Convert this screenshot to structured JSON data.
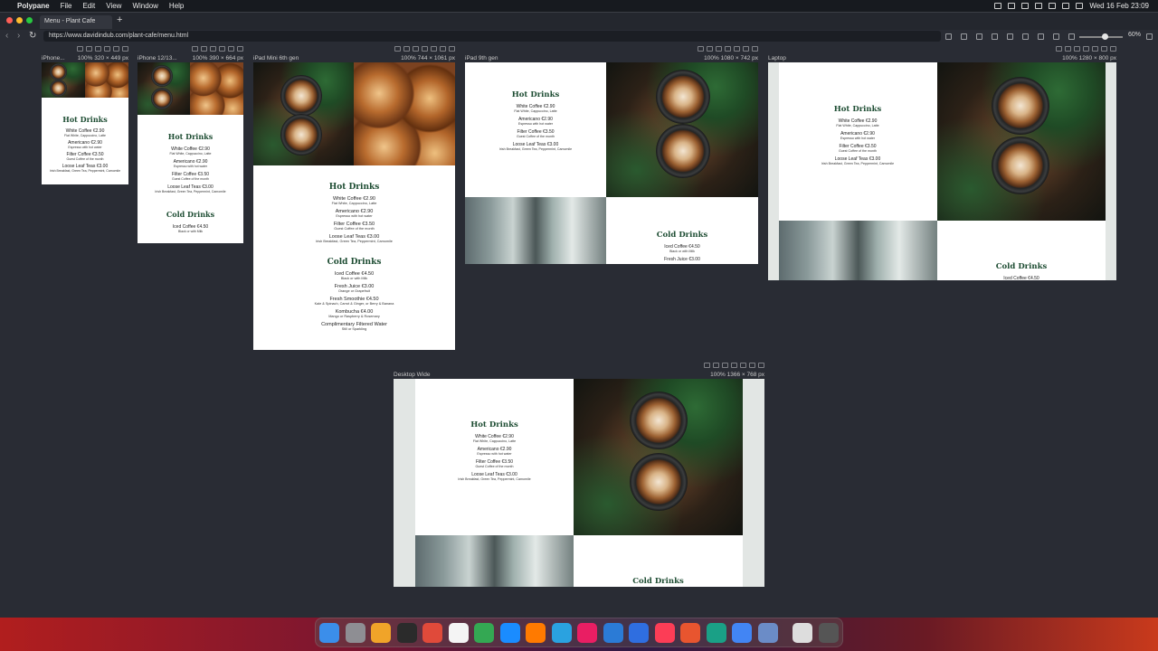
{
  "menubar": {
    "app": "Polypane",
    "items": [
      "File",
      "Edit",
      "View",
      "Window",
      "Help"
    ],
    "clock": "Wed 16 Feb  23:09"
  },
  "browser": {
    "tab_title": "Menu - Plant Cafe",
    "new_tab": "+",
    "url": "https://www.davidindub.com/plant-cafe/menu.html",
    "zoom": "60%"
  },
  "devices": [
    {
      "name": "iPhone...",
      "info": "100%   320 × 449 px"
    },
    {
      "name": "iPhone 12/13...",
      "info": "100%   390 × 664 px"
    },
    {
      "name": "iPad Mini 6th gen",
      "info": "100%   744 × 1061 px"
    },
    {
      "name": "iPad 9th gen",
      "info": "100%   1080 × 742 px"
    },
    {
      "name": "Laptop",
      "info": "100%   1280 × 800 px"
    },
    {
      "name": "Desktop Wide",
      "info": "100%   1366 × 768 px"
    }
  ],
  "menu": {
    "hot_title": "Hot Drinks",
    "cold_title": "Cold Drinks",
    "hot": [
      {
        "name": "White Coffee €2.90",
        "desc": "Flat White, Cappuccino, Latte"
      },
      {
        "name": "Americano €2.90",
        "desc": "Espresso with hot water"
      },
      {
        "name": "Filter Coffee €3.50",
        "desc": "Guest Coffee of the month"
      },
      {
        "name": "Loose Leaf Teas €3.00",
        "desc": "Irish Breakfast, Green Tea, Peppermint, Camomile"
      }
    ],
    "cold": [
      {
        "name": "Iced Coffee €4.50",
        "desc": "Black or with Milk"
      },
      {
        "name": "Fresh Juice €3.00",
        "desc": "Orange or Grapefruit"
      },
      {
        "name": "Fresh Smoothie €4.50",
        "desc": "Kale & Spinach, Carrot & Ginger, or Berry & Banana"
      },
      {
        "name": "Kombucha €4.00",
        "desc": "Mango or Raspberry & Rosemary"
      },
      {
        "name": "Complimentary Filtered Water",
        "desc": "Still or Sparkling"
      }
    ]
  },
  "dock_colors": [
    "#3b8eea",
    "#8e8e93",
    "#f0a429",
    "#2b2b2b",
    "#e04a3a",
    "#f4f4f4",
    "#34a853",
    "#1a8cff",
    "#ff7a00",
    "#2aa2e0",
    "#e91e63",
    "#2b7bd6",
    "#2f6ee0",
    "#fc3d56",
    "#e8552f",
    "#1aa086",
    "#4285f4",
    "#6b8cc7",
    "#ddd",
    "#555"
  ]
}
